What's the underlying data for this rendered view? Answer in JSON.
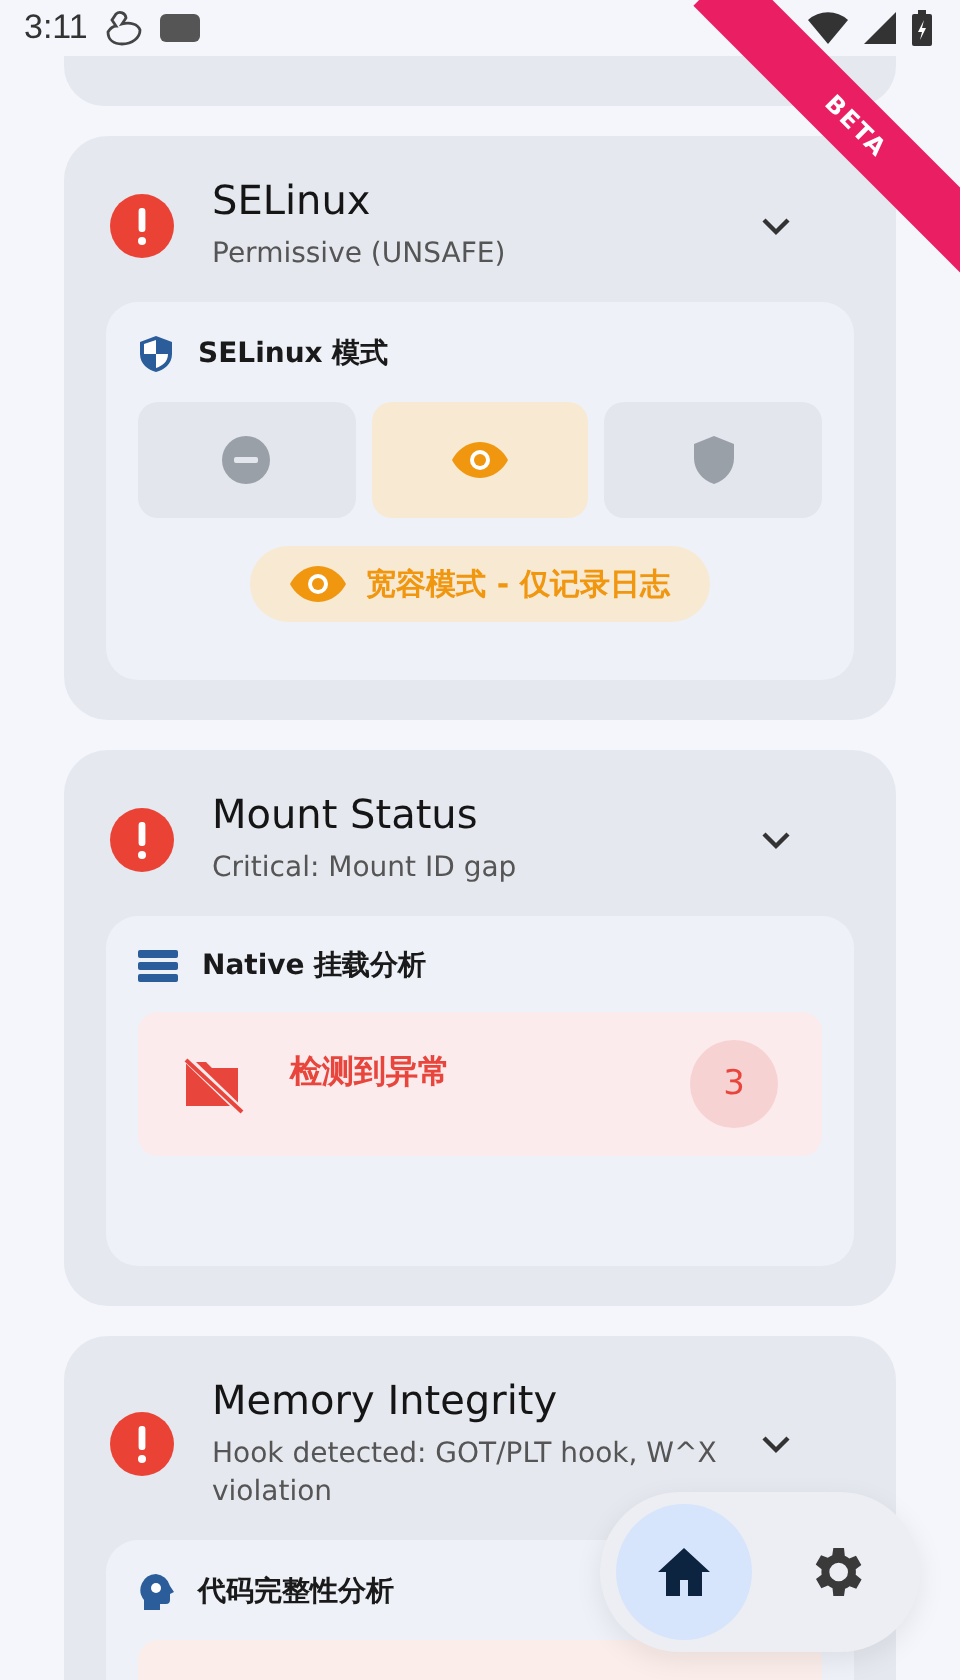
{
  "status_bar": {
    "time": "3:11"
  },
  "ribbon": {
    "label": "BETA"
  },
  "cards": [
    {
      "kind": "selinux",
      "title": "SELinux",
      "subtitle": "Permissive (UNSAFE)",
      "section": {
        "title": "SELinux 模式",
        "modes": [
          {
            "selected": false
          },
          {
            "selected": true
          },
          {
            "selected": false
          }
        ],
        "mode_label": "宽容模式 - 仅记录日志"
      }
    },
    {
      "kind": "mount",
      "title": "Mount Status",
      "subtitle": "Critical: Mount ID gap",
      "section": {
        "title": "Native 挂载分析",
        "alert": "检测到异常",
        "count": "3"
      }
    },
    {
      "kind": "memory",
      "title": "Memory Integrity",
      "subtitle": "Hook detected: GOT/PLT hook, W^X violation",
      "section": {
        "title": "代码完整性分析"
      }
    }
  ],
  "nav": [
    {
      "selected": true
    },
    {
      "selected": false
    }
  ]
}
